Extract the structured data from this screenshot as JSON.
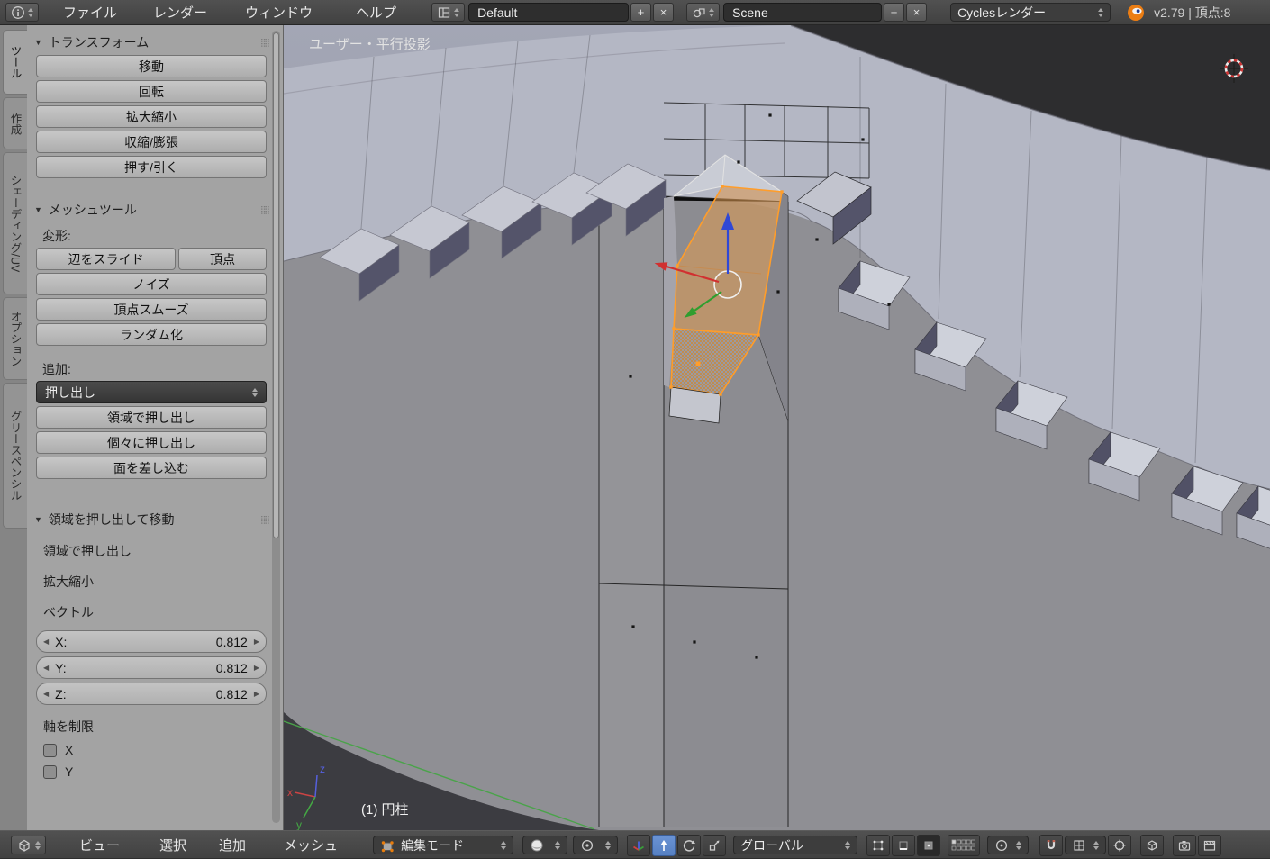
{
  "glyphs": {
    "collapse": "▼",
    "plus": "+",
    "close": "×",
    "left": "◀",
    "right": "▶",
    "grip": "⣿⣿"
  },
  "top_bar": {
    "menus": [
      "ファイル",
      "レンダー",
      "ウィンドウ",
      "ヘルプ"
    ],
    "layout_field": "Default",
    "scene_field": "Scene",
    "render_engine": "Cyclesレンダー",
    "version_text": "v2.79 | 頂点:8"
  },
  "tool_shelf": {
    "tabs": [
      "ツール",
      "作成",
      "シェーディング/UV",
      "オプション",
      "グリースペンシル"
    ],
    "transform_panel": {
      "title": "トランスフォーム",
      "buttons": [
        "移動",
        "回転",
        "拡大縮小",
        "収縮/膨張",
        "押す/引く"
      ]
    },
    "mesh_panel": {
      "title": "メッシュツール",
      "deform_label": "変形:",
      "edge_slide": "辺をスライド",
      "vertex_slide": "頂点",
      "buttons": [
        "ノイズ",
        "頂点スムーズ",
        "ランダム化"
      ],
      "add_label": "追加:",
      "extrude_select": "押し出し",
      "add_buttons": [
        "領域で押し出し",
        "個々に押し出し",
        "面を差し込む"
      ]
    },
    "operator_panel": {
      "title": "領域を押し出して移動",
      "op1": "領域で押し出し",
      "op2": "拡大縮小",
      "vector_label": "ベクトル",
      "fields": [
        {
          "label": "X:",
          "value": "0.812"
        },
        {
          "label": "Y:",
          "value": "0.812"
        },
        {
          "label": "Z:",
          "value": "0.812"
        }
      ],
      "constraint_label": "軸を制限",
      "axis_x": "X",
      "axis_y": "Y"
    }
  },
  "viewport": {
    "view_label": "ユーザー・平行投影",
    "object_label": "(1) 円柱",
    "axis": {
      "x": "x",
      "y": "y",
      "z": "z"
    }
  },
  "bottom_bar": {
    "menus": [
      "ビュー",
      "選択",
      "追加",
      "メッシュ"
    ],
    "mode_select": "編集モード",
    "orientation_select": "グローバル"
  },
  "colors": {
    "selection_orange": "#ff9d2a",
    "active_tool_blue": "#5680c2",
    "axis_x_red": "#d13030",
    "axis_y_green": "#2f9e2f",
    "axis_z_blue": "#3048d6",
    "header_bg": "#474747",
    "shelf_bg": "#a3a3a3",
    "mesh_top": "#b4b7c4",
    "mesh_wall": "#8f8f94"
  }
}
